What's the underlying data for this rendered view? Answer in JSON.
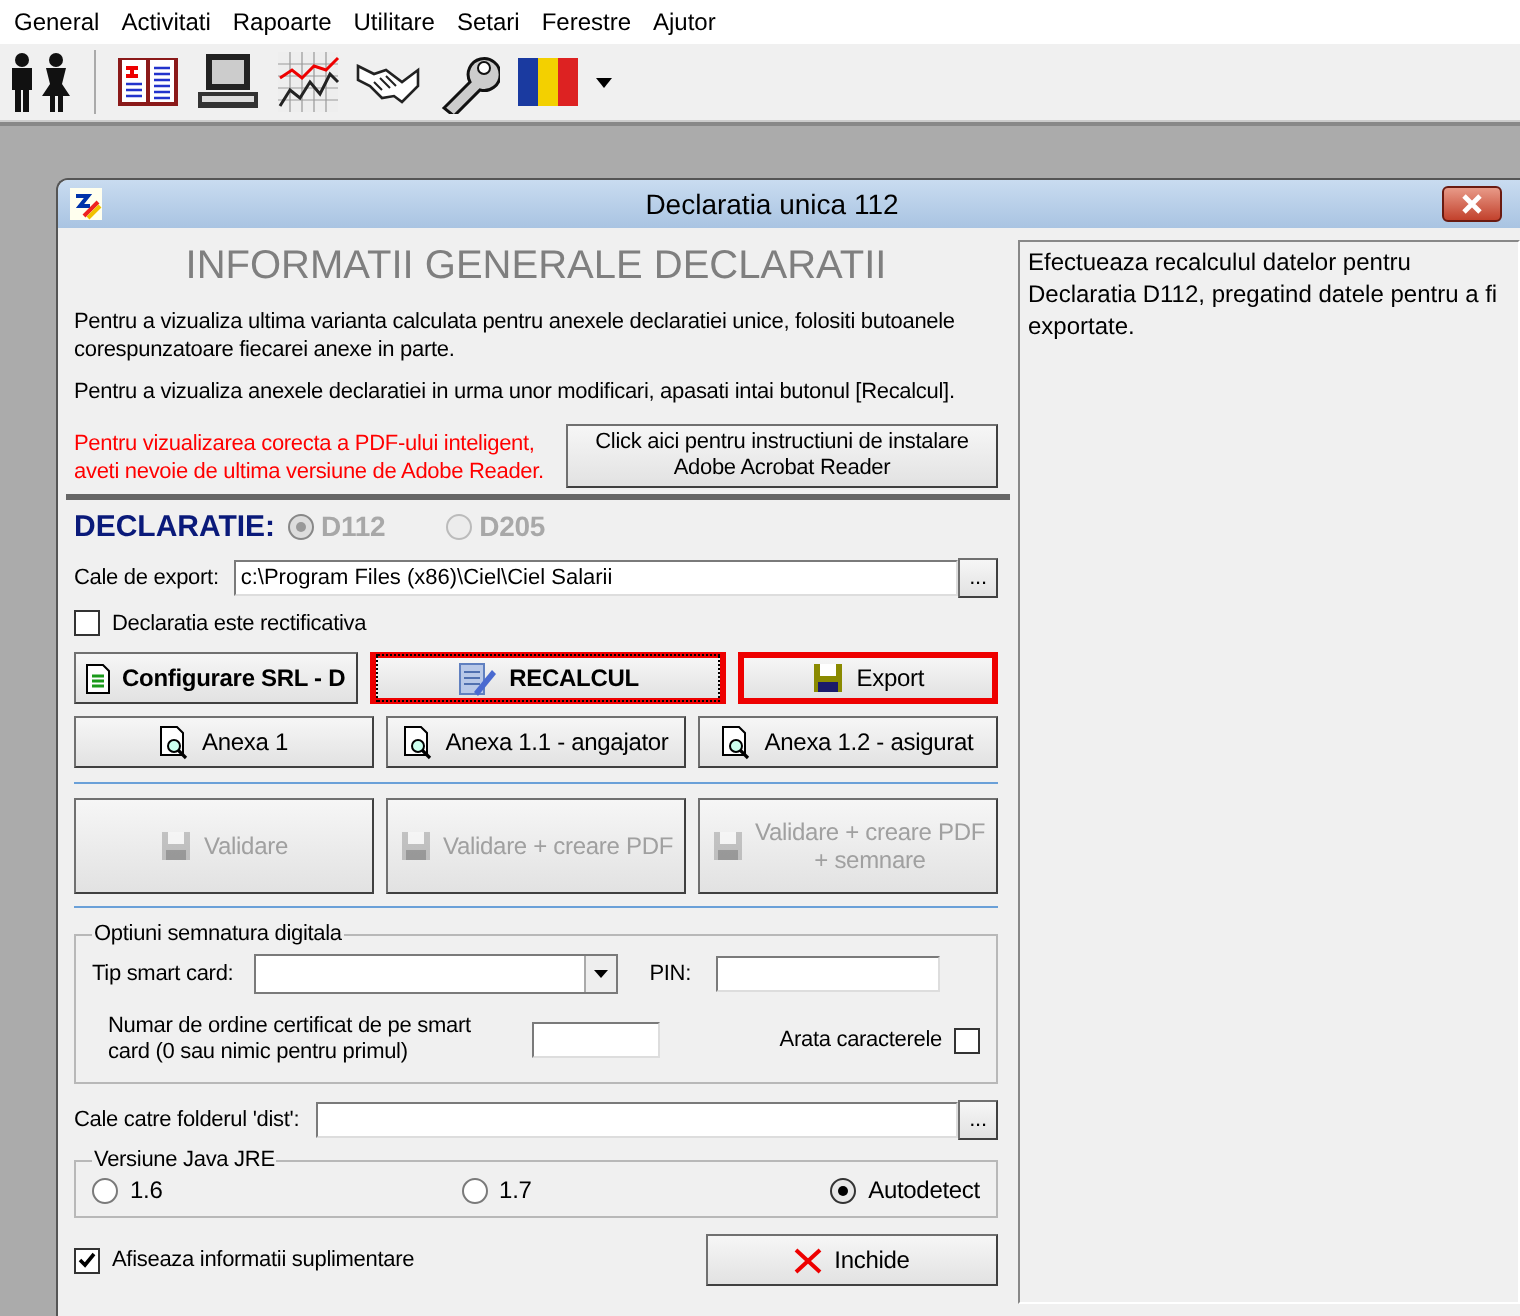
{
  "menu": [
    "General",
    "Activitati",
    "Rapoarte",
    "Utilitare",
    "Setari",
    "Ferestre",
    "Ajutor"
  ],
  "window": {
    "title": "Declaratia unica 112"
  },
  "heading": "INFORMATII GENERALE DECLARATII",
  "paragraphs": [
    "Pentru a vizualiza ultima varianta calculata pentru anexele declaratiei unice, folositi butoanele corespunzatoare fiecarei anexe in parte.",
    "Pentru a vizualiza anexele declaratiei in urma unor modificari, apasati intai butonul [Recalcul]."
  ],
  "warning": "Pentru vizualizarea corecta a PDF-ului inteligent, aveti nevoie de ultima versiune de Adobe Reader.",
  "install_button": "Click aici pentru instructiuni de instalare Adobe Acrobat Reader",
  "declaration": {
    "label": "DECLARATIE:",
    "options": [
      {
        "label": "D112",
        "selected": true
      },
      {
        "label": "D205",
        "selected": false
      }
    ]
  },
  "export_path": {
    "label": "Cale de export:",
    "value": "c:\\Program Files (x86)\\Ciel\\Ciel Salarii",
    "browse": "..."
  },
  "rectificativa": {
    "label": "Declaratia este rectificativa",
    "checked": false
  },
  "button_rows": [
    [
      {
        "label": "Configurare SRL - D",
        "kind": "sheet",
        "bold": true,
        "highlighted": false,
        "focused": false,
        "disabled": false
      },
      {
        "label": "RECALCUL",
        "kind": "recalc",
        "bold": true,
        "highlighted": true,
        "focused": true,
        "disabled": false
      },
      {
        "label": "Export",
        "kind": "floppy",
        "bold": false,
        "highlighted": true,
        "focused": false,
        "disabled": false
      }
    ],
    [
      {
        "label": "Anexa 1",
        "kind": "preview",
        "bold": false,
        "highlighted": false,
        "focused": false,
        "disabled": false
      },
      {
        "label": "Anexa 1.1 - angajator",
        "kind": "preview",
        "bold": false,
        "highlighted": false,
        "focused": false,
        "disabled": false
      },
      {
        "label": "Anexa 1.2 - asigurat",
        "kind": "preview",
        "bold": false,
        "highlighted": false,
        "focused": false,
        "disabled": false
      }
    ],
    [
      {
        "label": "Validare",
        "kind": "floppy",
        "bold": false,
        "highlighted": false,
        "focused": false,
        "disabled": true
      },
      {
        "label": "Validare + creare PDF",
        "kind": "floppy",
        "bold": false,
        "highlighted": false,
        "focused": false,
        "disabled": true
      },
      {
        "label": "Validare + creare PDF + semnare",
        "kind": "floppy",
        "bold": false,
        "highlighted": false,
        "focused": false,
        "disabled": true
      }
    ]
  ],
  "signature": {
    "title": "Optiuni semnatura digitala",
    "smart_card_label": "Tip smart card:",
    "pin_label": "PIN:",
    "cert_label": "Numar de ordine certificat de pe smart card (0 sau nimic pentru primul)",
    "show_chars": {
      "label": "Arata caracterele",
      "checked": false
    }
  },
  "dist_path": {
    "label": "Cale catre folderul 'dist':",
    "browse": "..."
  },
  "java": {
    "title": "Versiune Java JRE",
    "options": [
      {
        "label": "1.6",
        "selected": false
      },
      {
        "label": "1.7",
        "selected": false
      },
      {
        "label": "Autodetect",
        "selected": true
      }
    ]
  },
  "show_more": {
    "label": "Afiseaza informatii suplimentare",
    "checked": true
  },
  "close_button": "Inchide",
  "info_text": "Efectueaza recalculul datelor pentru Declaratia D112, pregatind datele pentru a fi exportate."
}
